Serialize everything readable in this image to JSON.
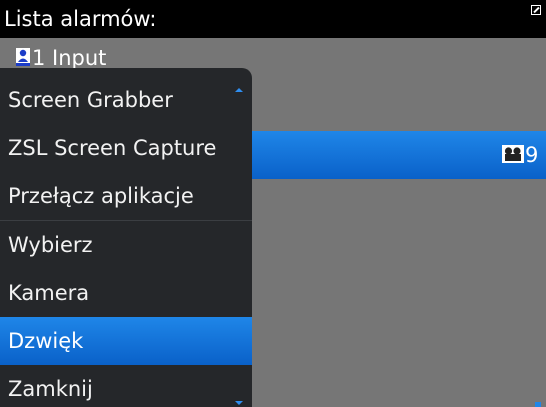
{
  "header": {
    "title": "Lista alarmów:",
    "corner_icon": "expand-icon"
  },
  "list": {
    "input_item": {
      "icon": "person-icon",
      "label": "1 Input"
    },
    "selected_item": {
      "icon": "camera-icon",
      "count": "9"
    }
  },
  "menu": {
    "items": [
      {
        "label": "Screen Grabber"
      },
      {
        "label": "ZSL Screen Capture"
      },
      {
        "label": "Przełącz aplikacje"
      },
      {
        "label": "Wybierz"
      },
      {
        "label": "Kamera"
      },
      {
        "label": "Dzwięk"
      },
      {
        "label": "Zamknij"
      }
    ],
    "active_item": "Dzwięk"
  },
  "colors": {
    "accent": "#0a61c9",
    "menu_background": "#25272a",
    "screen_background": "#767676"
  }
}
